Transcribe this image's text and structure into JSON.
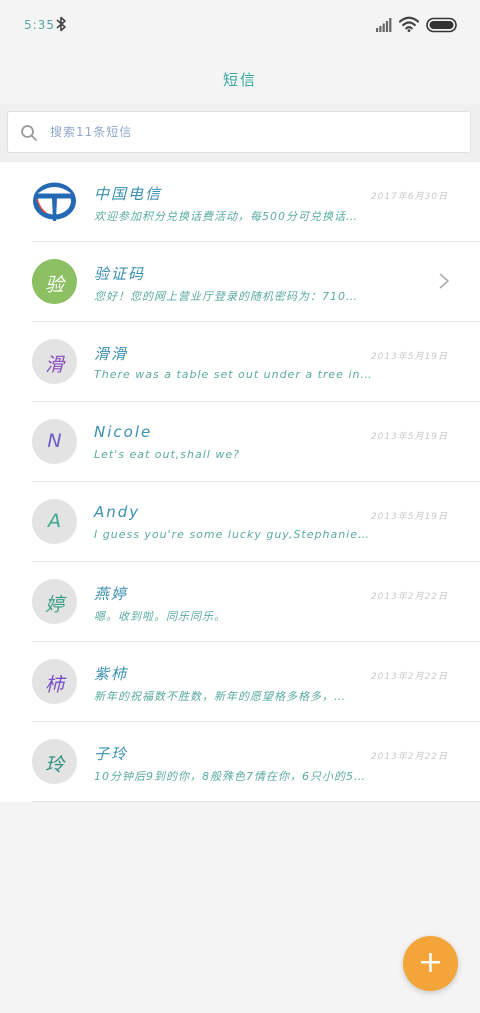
{
  "status_bar": {
    "time": "5:35"
  },
  "header": {
    "title": "短信"
  },
  "search": {
    "placeholder": "搜索11条短信"
  },
  "conversations": [
    {
      "avatar": "",
      "name": "中国电信",
      "date": "2017年6月30日",
      "preview": "欢迎参加积分兑换话费活动，每500分可兑换话…",
      "avatar_color": "#ffffff",
      "char_color": "#2469b3"
    },
    {
      "avatar": "验",
      "name": "验证码",
      "date": "",
      "preview": "您好！您的网上营业厅登录的随机密码为：710…",
      "avatar_color": "#8cc063",
      "char_color": "#ffffff"
    },
    {
      "avatar": "滑",
      "name": "滑滑",
      "date": "2013年5月19日",
      "preview": "There was a table set out under a tree in…",
      "avatar_color": "#e3e3e3",
      "char_color": "#8a4fc0"
    },
    {
      "avatar": "N",
      "name": "Nicole",
      "date": "2013年5月19日",
      "preview": "Let's eat out,shall we?",
      "avatar_color": "#e3e3e3",
      "char_color": "#6a5cc8"
    },
    {
      "avatar": "A",
      "name": "Andy",
      "date": "2013年5月19日",
      "preview": "I guess you're some lucky guy,Stephanie…",
      "avatar_color": "#e3e3e3",
      "char_color": "#3aa98f"
    },
    {
      "avatar": "婷",
      "name": "燕婷",
      "date": "2013年2月22日",
      "preview": "嗯。收到啦。同乐同乐。",
      "avatar_color": "#e3e3e3",
      "char_color": "#3a9f86"
    },
    {
      "avatar": "柿",
      "name": "紫柿",
      "date": "2013年2月22日",
      "preview": "新年的祝福数不胜数，新年的愿望格多格多，…",
      "avatar_color": "#e3e3e3",
      "char_color": "#7a4fc8"
    },
    {
      "avatar": "玲",
      "name": "子玲",
      "date": "2013年2月22日",
      "preview": "10分钟后9到的你，8般殊色7情在你，6只小的5…",
      "avatar_color": "#e3e3e3",
      "char_color": "#2f8f80"
    }
  ],
  "fab": {
    "label": "+"
  }
}
